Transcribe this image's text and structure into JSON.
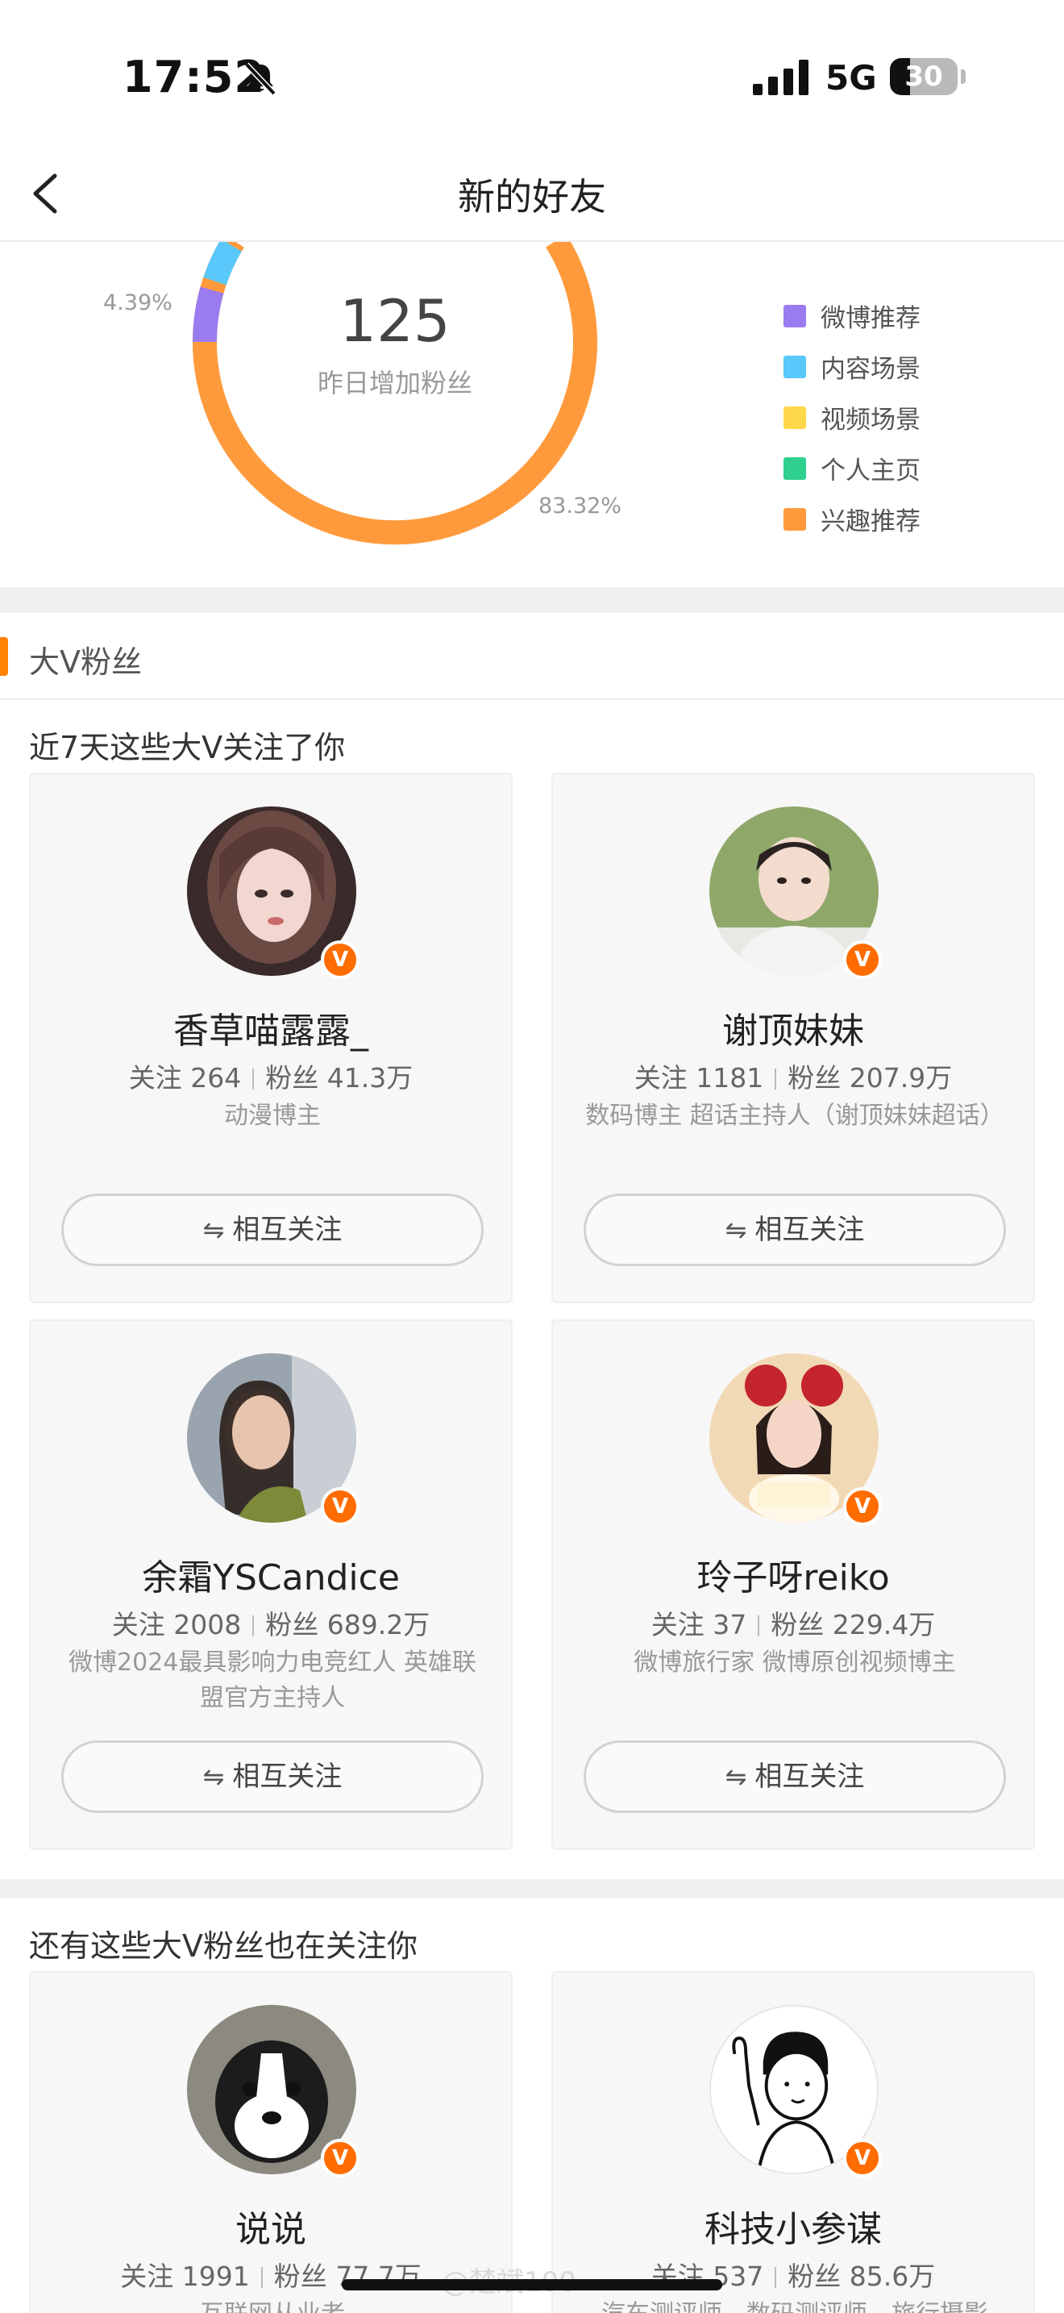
{
  "status_bar": {
    "time": "17:52",
    "network": "5G",
    "battery": "30",
    "battery_level": 0.3
  },
  "nav": {
    "title": "新的好友"
  },
  "donut": {
    "value": "125",
    "caption": "昨日增加粉丝",
    "pct_small": "4.39%",
    "pct_large": "83.32%",
    "legend": [
      {
        "label": "微博推荐",
        "color": "#9b7cf0"
      },
      {
        "label": "内容场景",
        "color": "#5ac8fa"
      },
      {
        "label": "视频场景",
        "color": "#ffd84a"
      },
      {
        "label": "个人主页",
        "color": "#2fd08f"
      },
      {
        "label": "兴趣推荐",
        "color": "#ff9a3c"
      }
    ]
  },
  "section": {
    "title": "大V粉丝"
  },
  "recent": {
    "title": "近7天这些大V关注了你",
    "cards": [
      {
        "name": "香草喵露露_",
        "following_label": "关注",
        "following": "264",
        "fans_label": "粉丝",
        "fans": "41.3万",
        "desc": "动漫博主",
        "button": "相互关注",
        "avatar_icon": "avatar-photo-icon"
      },
      {
        "name": "谢顶妹妹",
        "following_label": "关注",
        "following": "1181",
        "fans_label": "粉丝",
        "fans": "207.9万",
        "desc": "数码博主 超话主持人（谢顶妹妹超话）",
        "button": "相互关注",
        "avatar_icon": "avatar-photo-icon"
      },
      {
        "name": "余霜YSCandice",
        "following_label": "关注",
        "following": "2008",
        "fans_label": "粉丝",
        "fans": "689.2万",
        "desc": "微博2024最具影响力电竞红人 英雄联盟官方主持人",
        "button": "相互关注",
        "avatar_icon": "avatar-photo-icon"
      },
      {
        "name": "玲子呀reiko",
        "following_label": "关注",
        "following": "37",
        "fans_label": "粉丝",
        "fans": "229.4万",
        "desc": "微博旅行家 微博原创视频博主",
        "button": "相互关注",
        "avatar_icon": "avatar-photo-icon"
      }
    ]
  },
  "more": {
    "title": "还有这些大V粉丝也在关注你",
    "cards": [
      {
        "name": "说说",
        "following_label": "关注",
        "following": "1991",
        "fans_label": "粉丝",
        "fans": "77.7万",
        "desc": "互联网从业者",
        "avatar_icon": "dog-avatar-icon"
      },
      {
        "name": "科技小参谋",
        "following_label": "关注",
        "following": "537",
        "fans_label": "粉丝",
        "fans": "85.6万",
        "desc": "汽车测评师、数码测评师、旅行摄影",
        "avatar_icon": "cartoon-avatar-icon"
      }
    ]
  },
  "badge_text": "V",
  "watermark": "@楚斌100"
}
